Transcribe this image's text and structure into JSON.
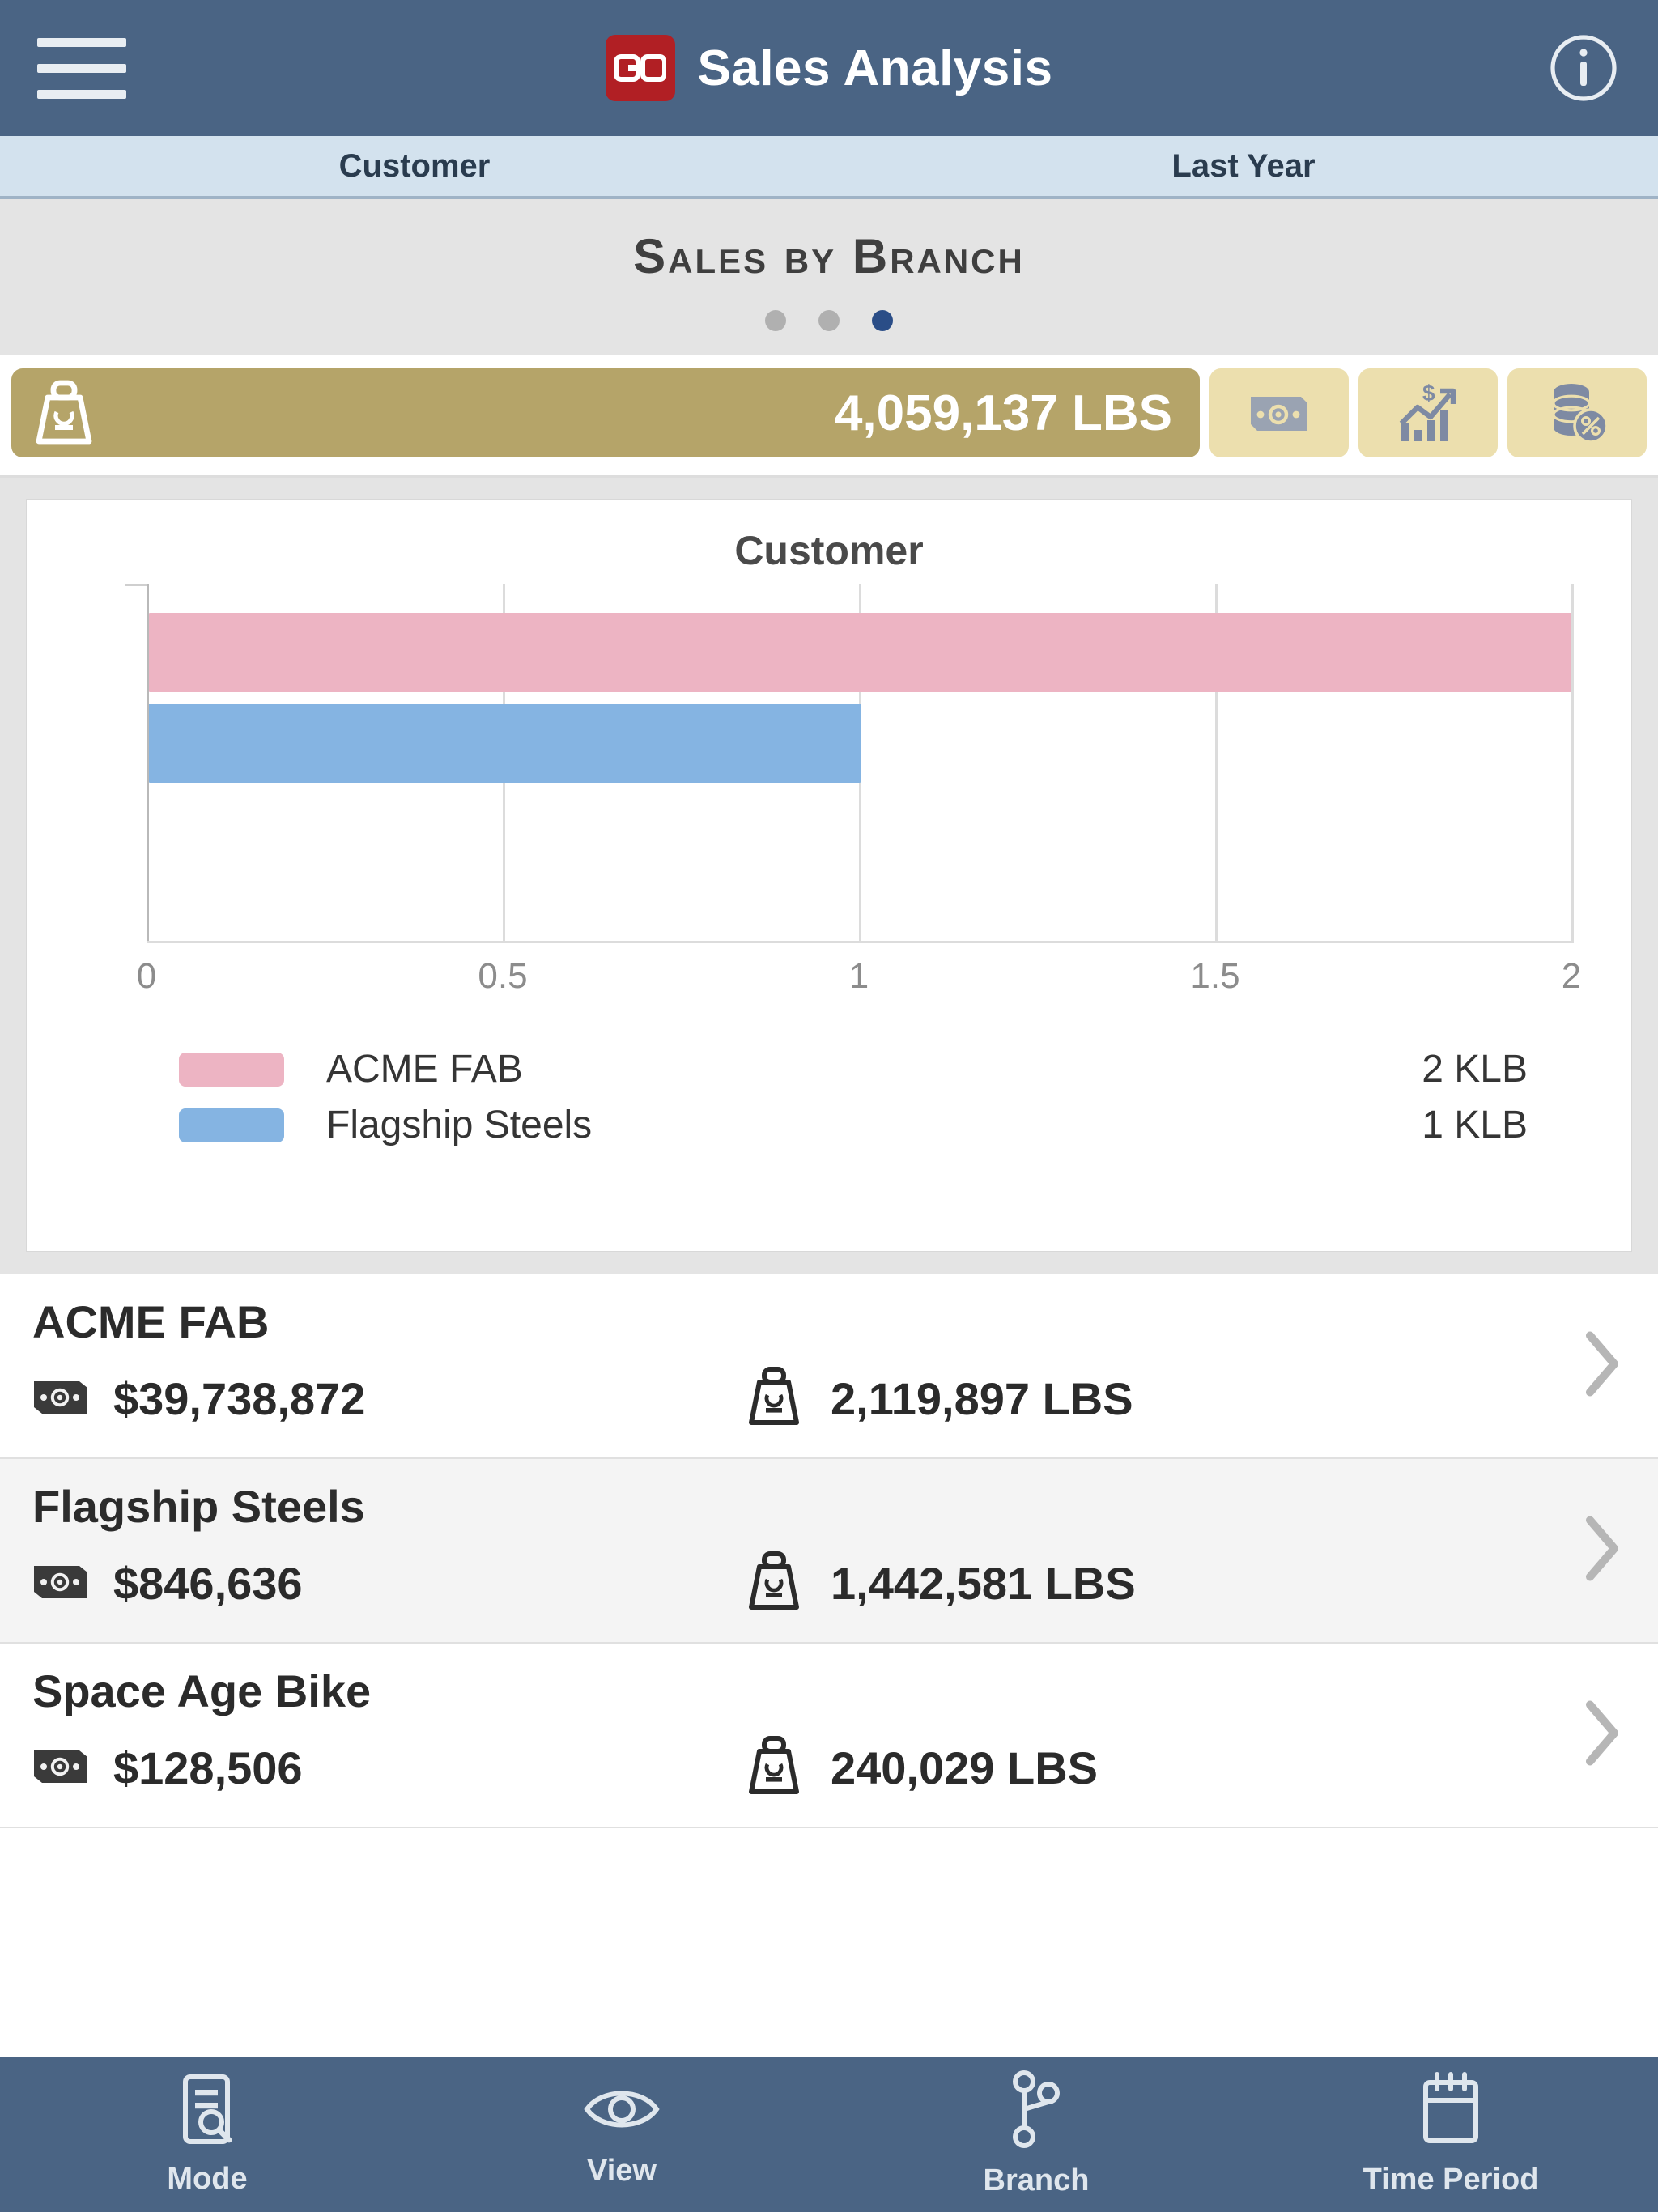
{
  "header": {
    "menu_icon": "hamburger-menu-icon",
    "logo_text": "GO",
    "title": "Sales Analysis",
    "info_icon": "info-icon"
  },
  "subheader": {
    "left": "Customer",
    "right": "Last Year"
  },
  "section": {
    "title": "Sales by Branch",
    "dots": [
      {
        "active": false
      },
      {
        "active": false
      },
      {
        "active": true
      }
    ]
  },
  "metrics": {
    "primary": {
      "icon": "weight-scale-icon",
      "value": "4,059,137 LBS",
      "active": true
    },
    "secondary": [
      {
        "icon": "banknote-icon",
        "active": false
      },
      {
        "icon": "growth-chart-dollar-icon",
        "active": false
      },
      {
        "icon": "coins-percent-icon",
        "active": false
      }
    ]
  },
  "chart_data": {
    "type": "bar",
    "orientation": "horizontal",
    "title": "Customer",
    "categories": [
      "ACME FAB",
      "Flagship Steels"
    ],
    "values": [
      2,
      1
    ],
    "value_labels": [
      "2 KLB",
      "1 KLB"
    ],
    "colors": [
      "#edb4c3",
      "#85b4e2"
    ],
    "xlabel": "",
    "ylabel": "",
    "xlim": [
      0,
      2
    ],
    "xticks": [
      0,
      0.5,
      1,
      1.5,
      2
    ],
    "xtick_labels": [
      "0",
      "0.5",
      "1",
      "1.5",
      "2"
    ],
    "grid": true,
    "legend": "bottom"
  },
  "list": {
    "rows": [
      {
        "name": "ACME FAB",
        "money_icon": "banknote-icon",
        "money": "$39,738,872",
        "weight_icon": "weight-scale-icon",
        "weight": "2,119,897 LBS",
        "chevron": "chevron-right-icon"
      },
      {
        "name": "Flagship Steels",
        "money_icon": "banknote-icon",
        "money": "$846,636",
        "weight_icon": "weight-scale-icon",
        "weight": "1,442,581 LBS",
        "chevron": "chevron-right-icon"
      },
      {
        "name": "Space Age Bike",
        "money_icon": "banknote-icon",
        "money": "$128,506",
        "weight_icon": "weight-scale-icon",
        "weight": "240,029 LBS",
        "chevron": "chevron-right-icon"
      }
    ]
  },
  "bottom_nav": {
    "items": [
      {
        "label": "Mode",
        "icon": "document-search-icon"
      },
      {
        "label": "View",
        "icon": "eye-icon"
      },
      {
        "label": "Branch",
        "icon": "branch-nodes-icon"
      },
      {
        "label": "Time Period",
        "icon": "calendar-icon"
      }
    ]
  },
  "colors": {
    "header_blue": "#4a6484",
    "subheader_blue": "#d3e2ee",
    "band_gray": "#e4e4e4",
    "tile_active_gold": "#b5a469",
    "tile_inactive_gold": "#ecdfae",
    "logo_red": "#b11f24",
    "dot_active": "#2a4d87",
    "series_pink": "#edb4c3",
    "series_blue": "#85b4e2"
  }
}
